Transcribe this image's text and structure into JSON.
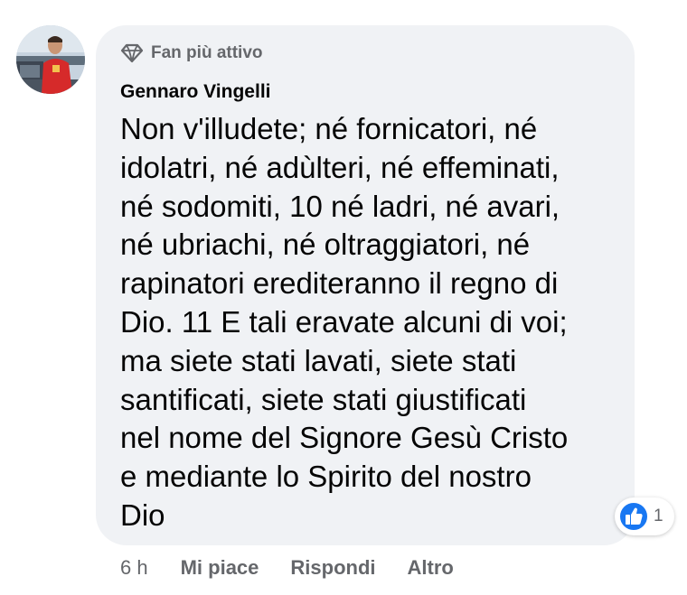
{
  "comment": {
    "badge_label": "Fan più attivo",
    "author_name": "Gennaro Vingelli",
    "body": "Non v'illudete; né fornicatori, né\nidolatri, né adùlteri, né effeminati,\nné sodomiti, 10 né ladri, né avari,\nné ubriachi, né oltraggiatori, né\nrapinatori erediteranno il regno di\nDio. 11 E tali eravate alcuni di voi;\nma siete stati lavati, siete stati\nsantificati, siete stati giustificati\nnel nome del Signore Gesù Cristo\ne mediante lo Spirito del nostro\nDio",
    "reactions": {
      "icon": "like-icon",
      "count": "1"
    },
    "footer": {
      "time": "6 h",
      "like_label": "Mi piace",
      "reply_label": "Rispondi",
      "more_label": "Altro"
    }
  },
  "colors": {
    "bubble_bg": "#f0f2f5",
    "meta_text": "#65676b",
    "primary_text": "#050505",
    "like_blue": "#1877f2"
  }
}
